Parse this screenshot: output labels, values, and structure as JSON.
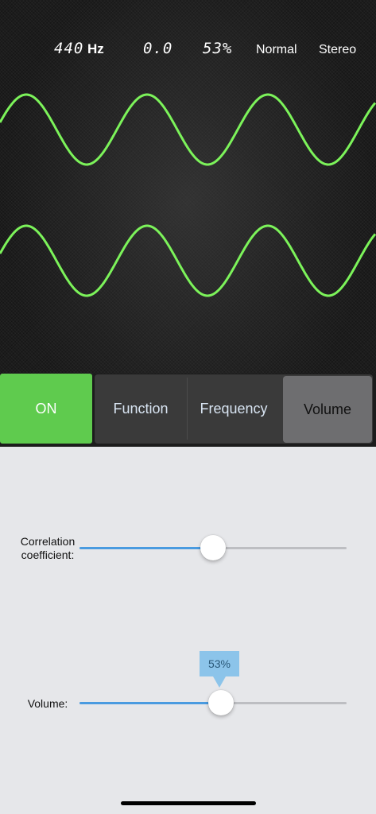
{
  "readouts": {
    "frequency_value": "440",
    "frequency_unit": "Hz",
    "correlation_value": "0.0",
    "volume_value": "53%",
    "mode": "Normal",
    "channels": "Stereo"
  },
  "controls": {
    "on_label": "ON",
    "function_label": "Function",
    "frequency_label": "Frequency",
    "volume_label": "Volume",
    "selected_tab": "Volume"
  },
  "sliders": {
    "correlation": {
      "label": "Correlation coefficient:",
      "fraction": 0.5
    },
    "volume": {
      "label": "Volume:",
      "fraction": 0.53,
      "tooltip": "53%"
    }
  },
  "colors": {
    "wave": "#7cf35a",
    "on_button": "#5fcb4e",
    "slider_fill": "#4a9be0",
    "tooltip_bg": "#8cc4ea"
  }
}
